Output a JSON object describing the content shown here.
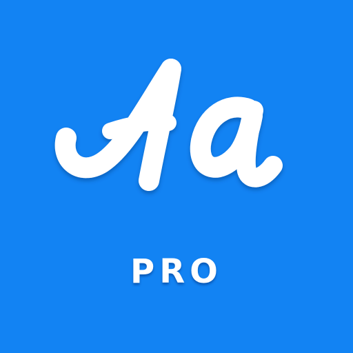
{
  "icon": {
    "background_color": "#1283f3",
    "glyph_color": "#ffffff",
    "logo_text": "Aa",
    "badge": "PRO"
  }
}
